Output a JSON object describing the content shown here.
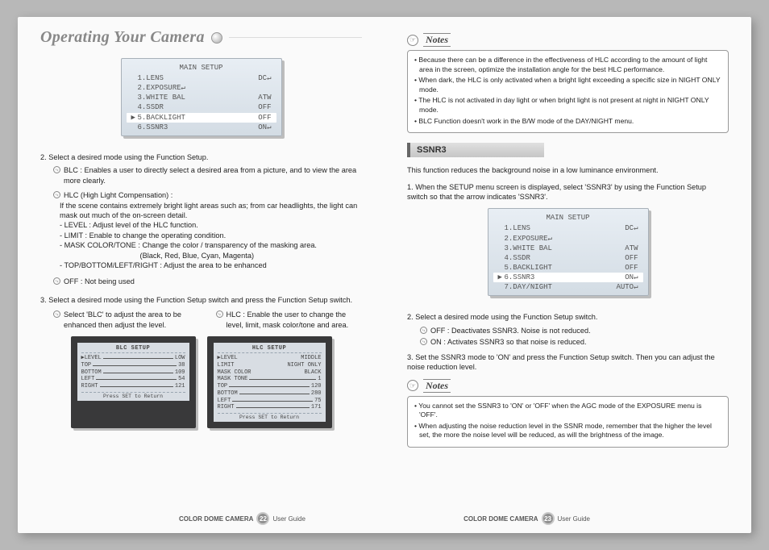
{
  "title": "Operating Your Camera",
  "left": {
    "menu": {
      "title": "MAIN SETUP",
      "rows": [
        {
          "l": "1.LENS",
          "r": "DC↵"
        },
        {
          "l": "2.EXPOSURE↵",
          "r": ""
        },
        {
          "l": "3.WHITE BAL",
          "r": "ATW"
        },
        {
          "l": "4.SSDR",
          "r": "OFF"
        },
        {
          "l": "5.BACKLIGHT",
          "r": "OFF",
          "sel": true
        },
        {
          "l": "6.SSNR3",
          "r": "ON↵"
        }
      ]
    },
    "step2": "2. Select a desired mode using the Function Setup.",
    "blc_label": "BLC :",
    "blc_text": "Enables a user to directly select a desired area from a picture, and to view the area more clearly.",
    "hlc_label": "HLC (High Light Compensation) :",
    "hlc_text": "If the scene contains extremely bright light areas such as; from car headlights, the light can mask out much of the on-screen detail.",
    "hlc_sub": [
      "- LEVEL : Adjust level of the HLC function.",
      "- LIMIT : Enable to change the operating condition.",
      "- MASK COLOR/TONE : Change the color / transparency of the masking area.",
      "                                       (Black, Red, Blue, Cyan, Magenta)",
      "- TOP/BOTTOM/LEFT/RIGHT : Adjust the area to be enhanced"
    ],
    "off_label": "OFF :",
    "off_text": "Not being used",
    "step3": "3. Select a desired mode using the Function Setup switch and press the Function Setup switch.",
    "desc_blc": "Select 'BLC' to adjust the area to be enhanced then adjust the level.",
    "desc_hlc": "Enable the user to change the level, limit, mask color/tone and area.",
    "mini_blc": {
      "title": "BLC SETUP",
      "rows": [
        {
          "l": "▶LEVEL",
          "r": "LOW"
        },
        {
          "l": "TOP",
          "r": "38"
        },
        {
          "l": "BOTTOM",
          "r": "109"
        },
        {
          "l": "LEFT",
          "r": "54"
        },
        {
          "l": "RIGHT",
          "r": "121"
        }
      ],
      "footer": "Press SET to Return"
    },
    "mini_hlc": {
      "title": "HLC SETUP",
      "rows": [
        {
          "l": "▶LEVEL",
          "r": "MIDDLE"
        },
        {
          "l": "LIMIT",
          "r": "NIGHT ONLY"
        },
        {
          "l": "MASK COLOR",
          "r": "BLACK"
        },
        {
          "l": "MASK TONE",
          "r": "1"
        },
        {
          "l": "TOP",
          "r": "120"
        },
        {
          "l": "BOTTOM",
          "r": "280"
        },
        {
          "l": "LEFT",
          "r": "75"
        },
        {
          "l": "RIGHT",
          "r": "171"
        }
      ],
      "footer": "Press SET to Return"
    }
  },
  "right": {
    "notes_label": "Notes",
    "notes1": [
      "Because there can be a difference in the effectiveness of HLC according to the amount of light area in the screen, optimize the installation angle for the best HLC performance.",
      "When dark, the HLC is only activated when a bright light exceeding a specific size in NIGHT ONLY mode.",
      "The HLC is not activated in day light or when bright light is not present at night in NIGHT ONLY mode.",
      "BLC Function doesn't work in the B/W mode of the DAY/NIGHT menu."
    ],
    "section": "SSNR3",
    "ssnr_intro": "This function reduces the background noise in a low luminance environment.",
    "ssnr_step1": "1. When the SETUP menu screen is displayed, select 'SSNR3' by using the Function Setup switch so that the arrow indicates 'SSNR3'.",
    "menu": {
      "title": "MAIN SETUP",
      "rows": [
        {
          "l": "1.LENS",
          "r": "DC↵"
        },
        {
          "l": "2.EXPOSURE↵",
          "r": ""
        },
        {
          "l": "3.WHITE BAL",
          "r": "ATW"
        },
        {
          "l": "4.SSDR",
          "r": "OFF"
        },
        {
          "l": "5.BACKLIGHT",
          "r": "OFF"
        },
        {
          "l": "6.SSNR3",
          "r": "ON↵",
          "sel": true
        },
        {
          "l": "7.DAY/NIGHT",
          "r": "AUTO↵"
        }
      ]
    },
    "ssnr_step2": "2. Select a desired mode using the Function Setup switch.",
    "ssnr_off": "Deactivates SSNR3. Noise is not reduced.",
    "ssnr_on": "Activates SSNR3 so that noise is reduced.",
    "ssnr_step3": "3. Set the SSNR3 mode to 'ON' and press the Function Setup switch. Then you can adjust the noise reduction level.",
    "notes2": [
      "You cannot set the SSNR3 to 'ON' or 'OFF' when the AGC mode of the EXPOSURE menu is 'OFF'.",
      "When adjusting the noise reduction level in the SSNR mode, remember that the higher the level set, the more the noise level will be reduced, as will the brightness of the image."
    ]
  },
  "footer": {
    "product": "COLOR DOME CAMERA",
    "guide": "User Guide",
    "page_left": "22",
    "page_right": "23"
  }
}
